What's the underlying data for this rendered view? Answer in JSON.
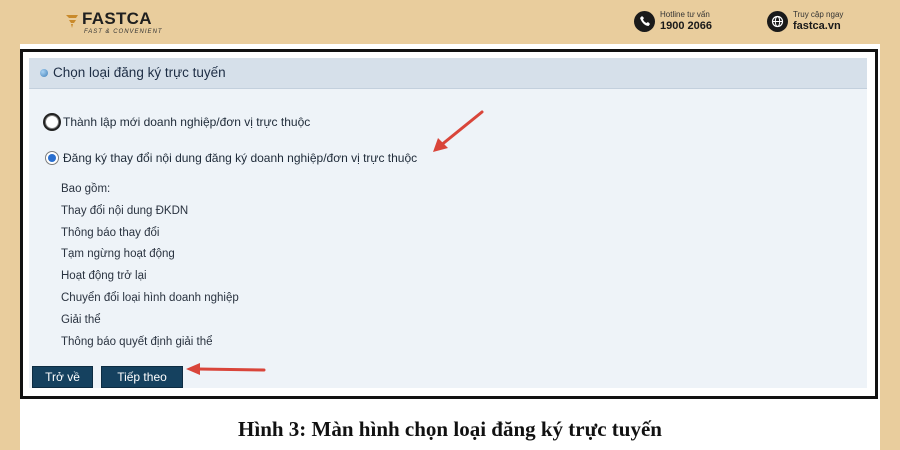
{
  "brand": {
    "name": "FASTCA",
    "tagline": "FAST & CONVENIENT",
    "hotline_label": "Hotline tư vấn",
    "hotline_number": "1900 2066",
    "web_label": "Truy cập ngay",
    "web_url": "fastca.vn",
    "accent_color": "#e9cd9d"
  },
  "panel": {
    "title": "Chọn loại đăng ký trực tuyến",
    "options": [
      {
        "label": "Thành lập mới doanh nghiệp/đơn vị trực thuộc",
        "selected": false
      },
      {
        "label": "Đăng ký thay đổi nội dung đăng ký doanh nghiệp/đơn vị trực thuộc",
        "selected": true
      }
    ],
    "includes": [
      "Bao gồm:",
      "Thay đổi nội dung ĐKDN",
      "Thông báo thay đổi",
      "Tạm ngừng hoạt động",
      "Hoạt động trở lại",
      "Chuyển đổi loại hình doanh nghiệp",
      "Giải thể",
      "Thông báo quyết định giải thể"
    ],
    "buttons": {
      "back": "Trở về",
      "next": "Tiếp theo"
    }
  },
  "caption": "Hình 3: Màn hình chọn loại đăng ký trực tuyến",
  "colors": {
    "button_bg": "#15415f",
    "annotation_arrow": "#d9453a",
    "panel_header_bg": "#d6e0ea"
  }
}
